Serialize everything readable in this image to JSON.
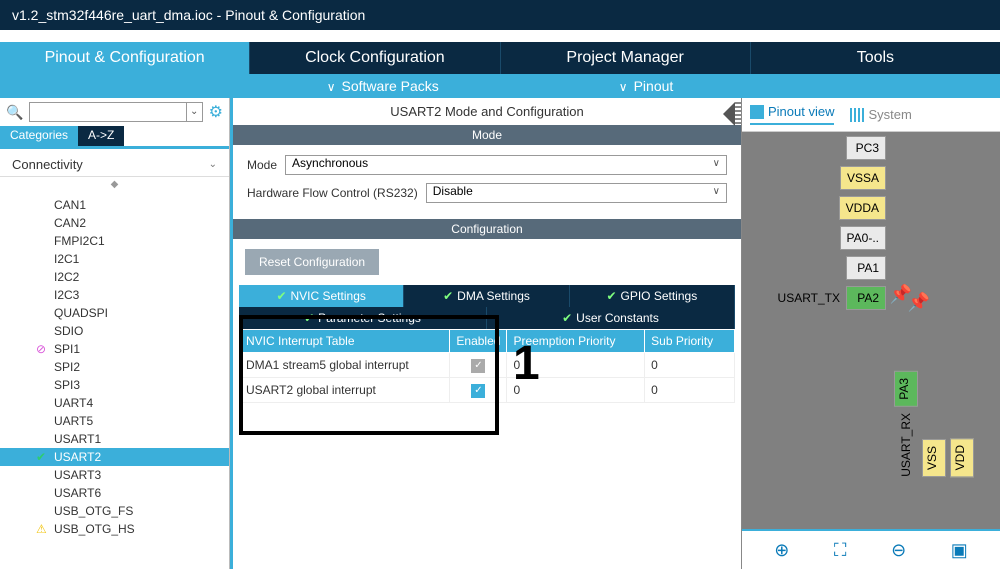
{
  "titlebar": "v1.2_stm32f446re_uart_dma.ioc - Pinout & Configuration",
  "topTabs": [
    "Pinout & Configuration",
    "Clock Configuration",
    "Project Manager",
    "Tools"
  ],
  "subbar": {
    "packs": "Software Packs",
    "pinout": "Pinout"
  },
  "sidebar": {
    "catTabs": {
      "active": "Categories",
      "alpha": "A->Z"
    },
    "section": "Connectivity",
    "items": [
      {
        "label": "CAN1",
        "badge": ""
      },
      {
        "label": "CAN2",
        "badge": ""
      },
      {
        "label": "FMPI2C1",
        "badge": ""
      },
      {
        "label": "I2C1",
        "badge": ""
      },
      {
        "label": "I2C2",
        "badge": ""
      },
      {
        "label": "I2C3",
        "badge": ""
      },
      {
        "label": "QUADSPI",
        "badge": ""
      },
      {
        "label": "SDIO",
        "badge": ""
      },
      {
        "label": "SPI1",
        "badge": "ban"
      },
      {
        "label": "SPI2",
        "badge": ""
      },
      {
        "label": "SPI3",
        "badge": ""
      },
      {
        "label": "UART4",
        "badge": ""
      },
      {
        "label": "UART5",
        "badge": ""
      },
      {
        "label": "USART1",
        "badge": ""
      },
      {
        "label": "USART2",
        "badge": "ok",
        "selected": true
      },
      {
        "label": "USART3",
        "badge": ""
      },
      {
        "label": "USART6",
        "badge": ""
      },
      {
        "label": "USB_OTG_FS",
        "badge": ""
      },
      {
        "label": "USB_OTG_HS",
        "badge": "warn"
      }
    ]
  },
  "center": {
    "title": "USART2 Mode and Configuration",
    "modeHeader": "Mode",
    "mode": {
      "label": "Mode",
      "value": "Asynchronous"
    },
    "hwflow": {
      "label": "Hardware Flow Control (RS232)",
      "value": "Disable"
    },
    "configHeader": "Configuration",
    "resetBtn": "Reset Configuration",
    "confTabs1": [
      "NVIC Settings",
      "DMA Settings",
      "GPIO Settings"
    ],
    "confTabs2": [
      "Parameter Settings",
      "User Constants"
    ],
    "nvicHeaders": [
      "NVIC Interrupt Table",
      "Enabled",
      "Preemption Priority",
      "Sub Priority"
    ],
    "nvicRows": [
      {
        "name": "DMA1 stream5 global interrupt",
        "enabled": true,
        "enDisabled": true,
        "pp": "0",
        "sp": "0"
      },
      {
        "name": "USART2 global interrupt",
        "enabled": true,
        "enDisabled": false,
        "pp": "0",
        "sp": "0"
      }
    ],
    "annotation": "1"
  },
  "right": {
    "tabs": {
      "pinout": "Pinout view",
      "system": "System"
    },
    "hpins": [
      {
        "label": "PC3",
        "cls": ""
      },
      {
        "label": "VSSA",
        "cls": "yellow"
      },
      {
        "label": "VDDA",
        "cls": "yellow"
      },
      {
        "label": "PA0-..",
        "cls": ""
      },
      {
        "label": "PA1",
        "cls": ""
      },
      {
        "label": "PA2",
        "cls": "green",
        "text": "USART_TX",
        "pin": true
      }
    ],
    "vpins": [
      {
        "label": "PA3",
        "cls": "green",
        "text": "USART_RX",
        "pin": true
      },
      {
        "label": "VSS",
        "cls": "yellow"
      },
      {
        "label": "VDD",
        "cls": "yellow"
      }
    ]
  }
}
